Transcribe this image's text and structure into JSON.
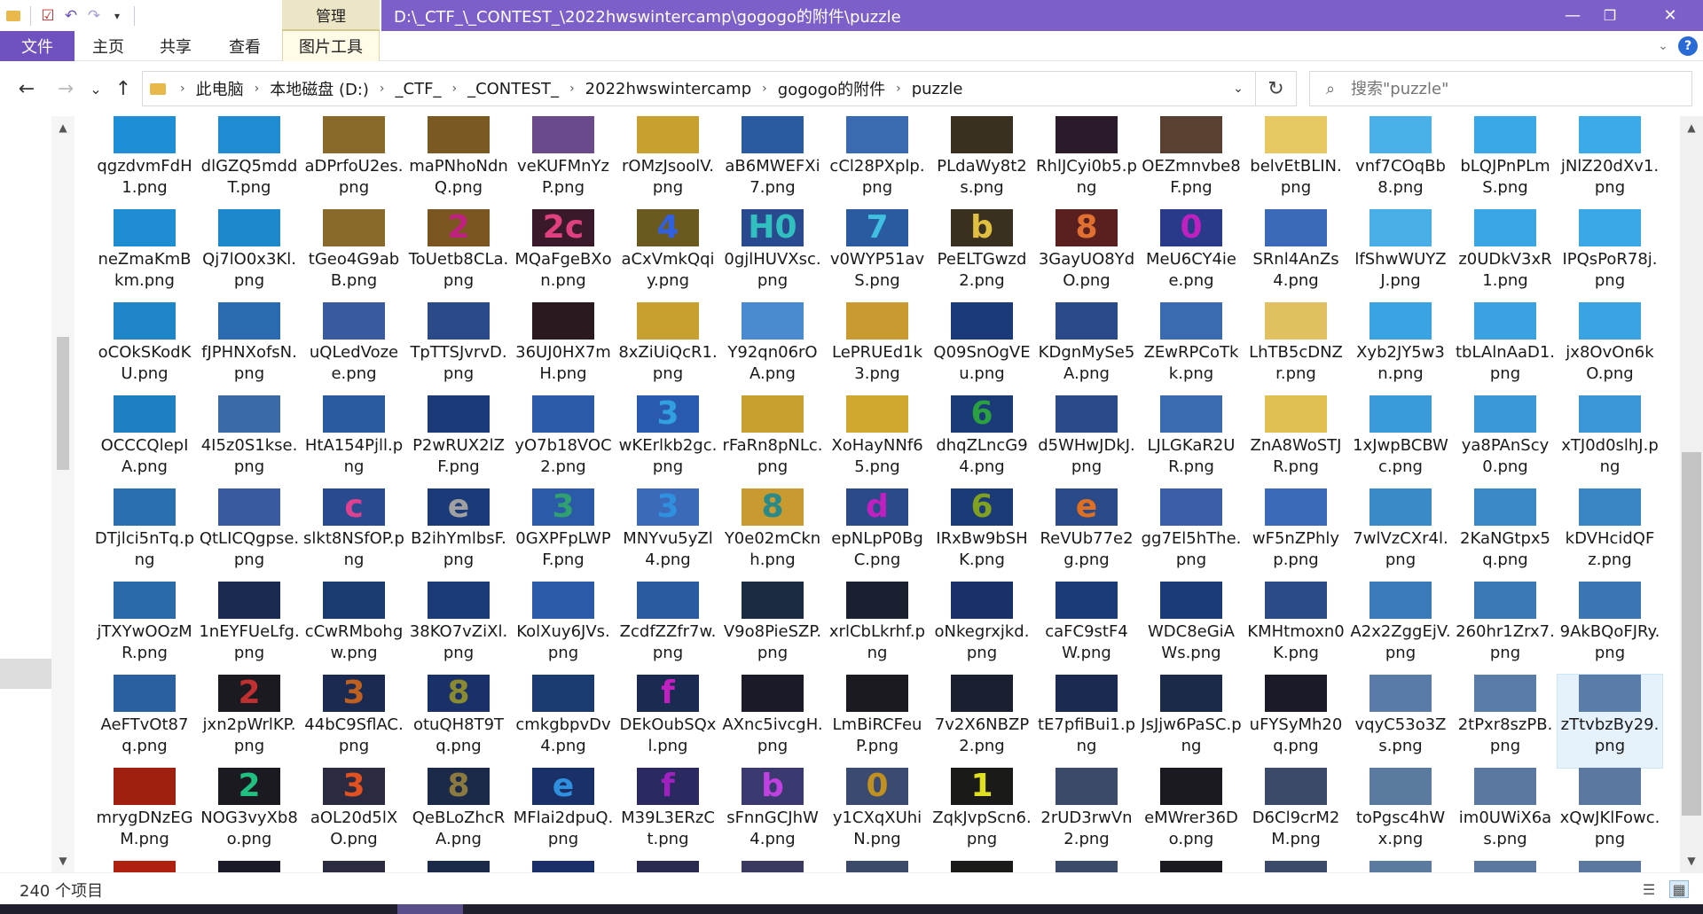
{
  "window": {
    "title": "D:\\_CTF_\\_CONTEST_\\2022hwswintercamp\\gogogo的附件\\puzzle",
    "manage_tab": "管理",
    "minimize": "—",
    "restore": "❐",
    "close": "✕",
    "accent_color": "#7c5fc9"
  },
  "quick_access": {
    "icons": [
      "folder-icon",
      "properties-icon",
      "undo-icon",
      "redo-icon",
      "customize-icon"
    ]
  },
  "ribbon": {
    "file": "文件",
    "home": "主页",
    "share": "共享",
    "view": "查看",
    "picture_tools": "图片工具"
  },
  "nav": {
    "back": "←",
    "forward": "→",
    "recent": "⌄",
    "up": "↑",
    "breadcrumb": [
      "此电脑",
      "本地磁盘 (D:)",
      "_CTF_",
      "_CONTEST_",
      "2022hwswintercamp",
      "gogogo的附件",
      "puzzle"
    ],
    "search_placeholder": "搜索\"puzzle\""
  },
  "files": [
    {
      "name": "qgzdvmFdH1.png",
      "bg": "#1e8fd6",
      "glyph": "",
      "gc": "#fff"
    },
    {
      "name": "dlGZQ5mddT.png",
      "bg": "#1f8bd0",
      "glyph": "",
      "gc": "#fff"
    },
    {
      "name": "aDPrfoU2es.png",
      "bg": "#8a6a2a",
      "glyph": "",
      "gc": "#fff"
    },
    {
      "name": "maPNhoNdnQ.png",
      "bg": "#7a5a22",
      "glyph": "",
      "gc": "#fff"
    },
    {
      "name": "veKUFMnYzP.png",
      "bg": "#6a4a8a",
      "glyph": "",
      "gc": "#fff"
    },
    {
      "name": "rOMzJsoolV.png",
      "bg": "#c8a030",
      "glyph": "",
      "gc": "#fff"
    },
    {
      "name": "aB6MWEFXi7.png",
      "bg": "#2a5aa0",
      "glyph": "",
      "gc": "#fff"
    },
    {
      "name": "cCl28PXplp.png",
      "bg": "#3a6ab0",
      "glyph": "",
      "gc": "#fff"
    },
    {
      "name": "PLdaWy8t2s.png",
      "bg": "#3a3020",
      "glyph": "",
      "gc": "#fff"
    },
    {
      "name": "RhlJCyi0b5.png",
      "bg": "#2a1a2a",
      "glyph": "",
      "gc": "#fff"
    },
    {
      "name": "OEZmnvbe8F.png",
      "bg": "#5a4030",
      "glyph": "",
      "gc": "#fff"
    },
    {
      "name": "belvEtBLIN.png",
      "bg": "#e8c860",
      "glyph": "",
      "gc": "#fff"
    },
    {
      "name": "vnf7COqBb8.png",
      "bg": "#4ab0e8",
      "glyph": "",
      "gc": "#fff"
    },
    {
      "name": "bLQJPnPLmS.png",
      "bg": "#3aa8e6",
      "glyph": "",
      "gc": "#fff"
    },
    {
      "name": "jNlZ20dXv1.png",
      "bg": "#3aaae8",
      "glyph": "",
      "gc": "#fff"
    },
    {
      "name": "neZmaKmBkm.png",
      "bg": "#1f8dd2",
      "glyph": "",
      "gc": "#fff"
    },
    {
      "name": "Qj7lO0x3Kl.png",
      "bg": "#1e88cc",
      "glyph": "",
      "gc": "#fff"
    },
    {
      "name": "tGeo4G9abB.png",
      "bg": "#8a6a2a",
      "glyph": "",
      "gc": "#fff"
    },
    {
      "name": "ToUetb8CLa.png",
      "bg": "#7a5520",
      "glyph": "2",
      "gc": "#c02080"
    },
    {
      "name": "MQaFgeBXon.png",
      "bg": "#3a1a2a",
      "glyph": "2c",
      "gc": "#e04080"
    },
    {
      "name": "aCxVmkQqiy.png",
      "bg": "#6a5a20",
      "glyph": "4",
      "gc": "#3060e0"
    },
    {
      "name": "0gjlHUVXsc.png",
      "bg": "#2a4a90",
      "glyph": "H0",
      "gc": "#30c0c0"
    },
    {
      "name": "v0WYP51avS.png",
      "bg": "#2a5aa0",
      "glyph": "7",
      "gc": "#40c0e0"
    },
    {
      "name": "PeELTGwzd2.png",
      "bg": "#3a3020",
      "glyph": "b",
      "gc": "#e0c040"
    },
    {
      "name": "3GayUO8YdO.png",
      "bg": "#5a2020",
      "glyph": "8",
      "gc": "#e07030"
    },
    {
      "name": "MeU6CY4iee.png",
      "bg": "#2a3a8a",
      "glyph": "0",
      "gc": "#c020c0"
    },
    {
      "name": "SRnl4AnZs4.png",
      "bg": "#3a6ab8",
      "glyph": "",
      "gc": "#fff"
    },
    {
      "name": "lfShwWUYZJ.png",
      "bg": "#4aaee6",
      "glyph": "",
      "gc": "#fff"
    },
    {
      "name": "z0UDkV3xR1.png",
      "bg": "#3aa6e4",
      "glyph": "",
      "gc": "#fff"
    },
    {
      "name": "IPQsPoR78j.png",
      "bg": "#3aa8e6",
      "glyph": "",
      "gc": "#fff"
    },
    {
      "name": "oCOkSKodKU.png",
      "bg": "#1e86c8",
      "glyph": "",
      "gc": "#fff"
    },
    {
      "name": "fJPHNXofsN.png",
      "bg": "#2a6ab0",
      "glyph": "",
      "gc": "#fff"
    },
    {
      "name": "uQLedVozee.png",
      "bg": "#3a5aa0",
      "glyph": "",
      "gc": "#fff"
    },
    {
      "name": "TpTTSJvrvD.png",
      "bg": "#2a4a8a",
      "glyph": "",
      "gc": "#fff"
    },
    {
      "name": "36UJ0HX7mH.png",
      "bg": "#2a1a20",
      "glyph": "",
      "gc": "#fff"
    },
    {
      "name": "8xZiUiQcR1.png",
      "bg": "#c8a030",
      "glyph": "",
      "gc": "#fff"
    },
    {
      "name": "Y92qn06rOA.png",
      "bg": "#4a8ad0",
      "glyph": "",
      "gc": "#fff"
    },
    {
      "name": "LePRUEd1k3.png",
      "bg": "#c89a30",
      "glyph": "",
      "gc": "#fff"
    },
    {
      "name": "Q09SnOgVEu.png",
      "bg": "#1a3a7a",
      "glyph": "",
      "gc": "#fff"
    },
    {
      "name": "KDgnMySe5A.png",
      "bg": "#2a4a8a",
      "glyph": "",
      "gc": "#fff"
    },
    {
      "name": "ZEwRPCoTkk.png",
      "bg": "#3a6ab0",
      "glyph": "",
      "gc": "#fff"
    },
    {
      "name": "LhTB5cDNZr.png",
      "bg": "#e0c060",
      "glyph": "",
      "gc": "#fff"
    },
    {
      "name": "Xyb2JY5w3n.png",
      "bg": "#3aa4e2",
      "glyph": "",
      "gc": "#fff"
    },
    {
      "name": "tbLAlnAaD1.png",
      "bg": "#3aa2e0",
      "glyph": "",
      "gc": "#fff"
    },
    {
      "name": "jx8OvOn6kO.png",
      "bg": "#3aa4e2",
      "glyph": "",
      "gc": "#fff"
    },
    {
      "name": "OCCCQlepIA.png",
      "bg": "#1e80c0",
      "glyph": "",
      "gc": "#fff"
    },
    {
      "name": "4I5z0S1kse.png",
      "bg": "#3a6aa8",
      "glyph": "",
      "gc": "#fff"
    },
    {
      "name": "HtA154Pjll.png",
      "bg": "#2a5aa0",
      "glyph": "",
      "gc": "#fff"
    },
    {
      "name": "P2wRUX2lZF.png",
      "bg": "#1a3a7a",
      "glyph": "",
      "gc": "#fff"
    },
    {
      "name": "yO7b18VOC2.png",
      "bg": "#2a5aa8",
      "glyph": "",
      "gc": "#fff"
    },
    {
      "name": "wKErlkb2gc.png",
      "bg": "#2a5ab0",
      "glyph": "3",
      "gc": "#30a0e0"
    },
    {
      "name": "rFaRn8pNLc.png",
      "bg": "#c8a030",
      "glyph": "",
      "gc": "#fff"
    },
    {
      "name": "XoHayNNf65.png",
      "bg": "#d0a830",
      "glyph": "",
      "gc": "#fff"
    },
    {
      "name": "dhqZLncG94.png",
      "bg": "#1a3a78",
      "glyph": "6",
      "gc": "#2aa040"
    },
    {
      "name": "d5WHwJDkJ.png",
      "bg": "#2a4a8a",
      "glyph": "",
      "gc": "#fff"
    },
    {
      "name": "LJLGKaR2UR.png",
      "bg": "#3a6ab0",
      "glyph": "",
      "gc": "#fff"
    },
    {
      "name": "ZnA8WoSTJR.png",
      "bg": "#e0c050",
      "glyph": "",
      "gc": "#fff"
    },
    {
      "name": "1xJwpBCBWc.png",
      "bg": "#3a9ada",
      "glyph": "",
      "gc": "#fff"
    },
    {
      "name": "ya8PAnScy0.png",
      "bg": "#3a98d8",
      "glyph": "",
      "gc": "#fff"
    },
    {
      "name": "xTJ0d0slhJ.png",
      "bg": "#3a96d6",
      "glyph": "",
      "gc": "#fff"
    },
    {
      "name": "DTjlci5nTq.png",
      "bg": "#2a70b0",
      "glyph": "",
      "gc": "#fff"
    },
    {
      "name": "QtLICQgpse.png",
      "bg": "#3a5aa0",
      "glyph": "",
      "gc": "#fff"
    },
    {
      "name": "slkt8NSfOP.png",
      "bg": "#2a4a90",
      "glyph": "c",
      "gc": "#e04090"
    },
    {
      "name": "B2ihYmlbsF.png",
      "bg": "#1a3a7a",
      "glyph": "e",
      "gc": "#a0a0a0"
    },
    {
      "name": "0GXPFpLWPF.png",
      "bg": "#2a5aa8",
      "glyph": "3",
      "gc": "#30a070"
    },
    {
      "name": "MNYvu5yZl4.png",
      "bg": "#3a6ab8",
      "glyph": "3",
      "gc": "#3090e0"
    },
    {
      "name": "Y0e02mCknh.png",
      "bg": "#c89a30",
      "glyph": "8",
      "gc": "#2a8a8a"
    },
    {
      "name": "epNLpP0BgC.png",
      "bg": "#2a4a8a",
      "glyph": "d",
      "gc": "#c020c0"
    },
    {
      "name": "IRxBw9bSHK.png",
      "bg": "#1a3a78",
      "glyph": "6",
      "gc": "#80a020"
    },
    {
      "name": "ReVUb77e2g.png",
      "bg": "#2a4a8a",
      "glyph": "e",
      "gc": "#e07020"
    },
    {
      "name": "gg7El5hThe.png",
      "bg": "#3a5ea8",
      "glyph": "",
      "gc": "#fff"
    },
    {
      "name": "wF5nZPhlyp.png",
      "bg": "#3a6ab8",
      "glyph": "",
      "gc": "#fff"
    },
    {
      "name": "7wlVzCXr4l.png",
      "bg": "#3a8ac8",
      "glyph": "",
      "gc": "#fff"
    },
    {
      "name": "2KaNGtpx5q.png",
      "bg": "#3a88c6",
      "glyph": "",
      "gc": "#fff"
    },
    {
      "name": "kDVHcidQFz.png",
      "bg": "#3a86c4",
      "glyph": "",
      "gc": "#fff"
    },
    {
      "name": "jTXYwOOzMR.png",
      "bg": "#2a6aa8",
      "glyph": "",
      "gc": "#fff"
    },
    {
      "name": "1nEYFUeLfg.png",
      "bg": "#1a2a50",
      "glyph": "",
      "gc": "#fff"
    },
    {
      "name": "cCwRMbohgw.png",
      "bg": "#1a3a70",
      "glyph": "",
      "gc": "#fff"
    },
    {
      "name": "38KO7vZiXl.png",
      "bg": "#1a3a78",
      "glyph": "",
      "gc": "#fff"
    },
    {
      "name": "KolXuy6JVs.png",
      "bg": "#2a5aa8",
      "glyph": "",
      "gc": "#fff"
    },
    {
      "name": "ZcdfZZfr7w.png",
      "bg": "#2a5aa0",
      "glyph": "",
      "gc": "#fff"
    },
    {
      "name": "V9o8PieSZP.png",
      "bg": "#1a2a40",
      "glyph": "",
      "gc": "#fff"
    },
    {
      "name": "xrlCbLkrhf.png",
      "bg": "#1a2030",
      "glyph": "",
      "gc": "#fff"
    },
    {
      "name": "oNkegrxjkd.png",
      "bg": "#1a3068",
      "glyph": "",
      "gc": "#fff"
    },
    {
      "name": "caFC9stF4W.png",
      "bg": "#1a3a78",
      "glyph": "",
      "gc": "#fff"
    },
    {
      "name": "WDC8eGiAWs.png",
      "bg": "#1a3a78",
      "glyph": "",
      "gc": "#fff"
    },
    {
      "name": "KMHtmoxn0K.png",
      "bg": "#2a4a88",
      "glyph": "",
      "gc": "#fff"
    },
    {
      "name": "A2x2ZggEjV.png",
      "bg": "#3a7ab8",
      "glyph": "",
      "gc": "#fff"
    },
    {
      "name": "260hr1Zrx7.png",
      "bg": "#3a78b6",
      "glyph": "",
      "gc": "#fff"
    },
    {
      "name": "9AkBQoFJRy.png",
      "bg": "#3a76b4",
      "glyph": "",
      "gc": "#fff"
    },
    {
      "name": "AeFTvOt87q.png",
      "bg": "#2a60a0",
      "glyph": "",
      "gc": "#fff"
    },
    {
      "name": "jxn2pWrlKP.png",
      "bg": "#1a1a20",
      "glyph": "2",
      "gc": "#c03030"
    },
    {
      "name": "44bC9SflAC.png",
      "bg": "#1a2a50",
      "glyph": "3",
      "gc": "#c06020"
    },
    {
      "name": "otuQH8T9Tq.png",
      "bg": "#1a3068",
      "glyph": "8",
      "gc": "#8a8a30"
    },
    {
      "name": "cmkgbpvDv4.png",
      "bg": "#1a3a70",
      "glyph": "",
      "gc": "#fff"
    },
    {
      "name": "DEkOubSQxl.png",
      "bg": "#1a2a50",
      "glyph": "f",
      "gc": "#c020c0"
    },
    {
      "name": "AXnc5ivcgH.png",
      "bg": "#1a1a28",
      "glyph": "",
      "gc": "#fff"
    },
    {
      "name": "LmBiRCFeuP.png",
      "bg": "#1a1a20",
      "glyph": "",
      "gc": "#fff"
    },
    {
      "name": "7v2X6NBZP2.png",
      "bg": "#1a2030",
      "glyph": "",
      "gc": "#fff"
    },
    {
      "name": "tE7pfiBui1.png",
      "bg": "#1a2a50",
      "glyph": "",
      "gc": "#fff"
    },
    {
      "name": "JsJjw6PaSC.png",
      "bg": "#1a2a48",
      "glyph": "",
      "gc": "#fff"
    },
    {
      "name": "uFYSyMh20q.png",
      "bg": "#1a1a28",
      "glyph": "",
      "gc": "#fff"
    },
    {
      "name": "vqyC53o3Zs.png",
      "bg": "#5a7aa8",
      "glyph": "",
      "gc": "#fff"
    },
    {
      "name": "2tPxr8szPB.png",
      "bg": "#5a7ca8",
      "glyph": "",
      "gc": "#fff"
    },
    {
      "name": "zTtvbzBy29.png",
      "bg": "#5a7ca8",
      "glyph": "",
      "gc": "#fff"
    },
    {
      "name": "mrygDNzEGM.png",
      "bg": "#a02010",
      "glyph": "",
      "gc": "#fff"
    },
    {
      "name": "NOG3vyXb8o.png",
      "bg": "#1a1a20",
      "glyph": "2",
      "gc": "#20c080"
    },
    {
      "name": "aOL20d5lXO.png",
      "bg": "#2a2a40",
      "glyph": "3",
      "gc": "#e05020"
    },
    {
      "name": "QeBLoZhcRA.png",
      "bg": "#1a2a48",
      "glyph": "8",
      "gc": "#8a7a40"
    },
    {
      "name": "MFlai2dpuQ.png",
      "bg": "#1a3068",
      "glyph": "e",
      "gc": "#3090e0"
    },
    {
      "name": "M39L3ERzCt.png",
      "bg": "#2a2a60",
      "glyph": "f",
      "gc": "#a020c0"
    },
    {
      "name": "sFnnGCJhW4.png",
      "bg": "#3a3a70",
      "glyph": "b",
      "gc": "#c040e0"
    },
    {
      "name": "y1CXqXUhiN.png",
      "bg": "#3a4a70",
      "glyph": "0",
      "gc": "#c09020"
    },
    {
      "name": "ZqkJvpScn6.png",
      "bg": "#1a1a18",
      "glyph": "1",
      "gc": "#e0e020"
    },
    {
      "name": "2rUD3rwVn2.png",
      "bg": "#3a4a68",
      "glyph": "",
      "gc": "#fff"
    },
    {
      "name": "eMWrer36Do.png",
      "bg": "#1a1a20",
      "glyph": "",
      "gc": "#fff"
    },
    {
      "name": "D6Cl9crM2M.png",
      "bg": "#3a4a68",
      "glyph": "",
      "gc": "#fff"
    },
    {
      "name": "toPgsc4hWx.png",
      "bg": "#5a7aa0",
      "glyph": "",
      "gc": "#fff"
    },
    {
      "name": "im0UWiX6as.png",
      "bg": "#5a78a0",
      "glyph": "",
      "gc": "#fff"
    },
    {
      "name": "xQwJKlFowc.png",
      "bg": "#5a78a0",
      "glyph": "",
      "gc": "#fff"
    }
  ],
  "cut_row_colors": [
    "#b02010",
    "#1a1a28",
    "#2a2a40",
    "#1a2a48",
    "#1a3068",
    "#2a2a50",
    "#3a3a60",
    "#3a4a68",
    "#1a1a18",
    "#3a4a68",
    "#1a1a20",
    "#3a4a68",
    "#5a7aa0",
    "#5a78a0",
    "#5a78a0"
  ],
  "status": {
    "count": "240 个项目"
  }
}
